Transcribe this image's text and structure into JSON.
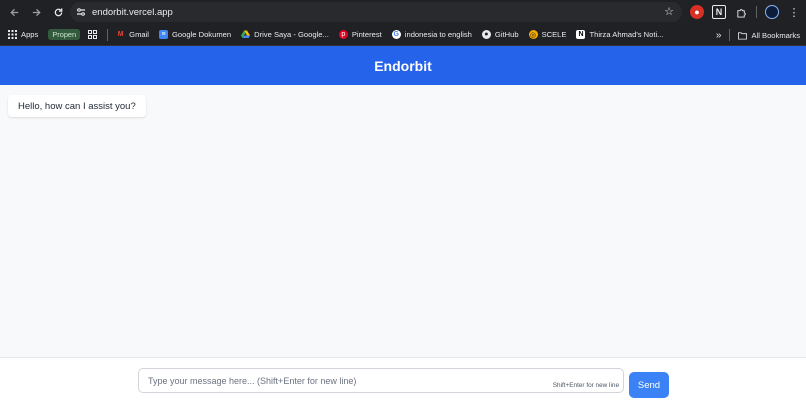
{
  "browser": {
    "url": "endorbit.vercel.app",
    "bookmarks": [
      {
        "label": "Apps",
        "icon": "apps-grid-icon"
      },
      {
        "label": "Propen",
        "icon": "folder-tag-icon"
      },
      {
        "label": "",
        "icon": "grid-icon"
      },
      {
        "label": "Gmail",
        "icon": "gmail-icon"
      },
      {
        "label": "Google Dokumen",
        "icon": "docs-icon"
      },
      {
        "label": "Drive Saya - Google...",
        "icon": "drive-icon"
      },
      {
        "label": "Pinterest",
        "icon": "pinterest-icon"
      },
      {
        "label": "indonesia to english",
        "icon": "google-icon"
      },
      {
        "label": "GitHub",
        "icon": "github-icon"
      },
      {
        "label": "SCELE",
        "icon": "scele-icon"
      },
      {
        "label": "Thirza Ahmad's Noti...",
        "icon": "notion-icon"
      }
    ],
    "all_bookmarks": "All Bookmarks",
    "more_chevron": "»"
  },
  "app": {
    "title": "Endorbit",
    "header_color": "#2563eb"
  },
  "messages": [
    {
      "role": "assistant",
      "text": "Hello, how can I assist you?"
    }
  ],
  "composer": {
    "placeholder": "Type your message here... (Shift+Enter for new line)",
    "value": "",
    "hint": "Shift+Enter for new line",
    "send_label": "Send",
    "send_color": "#3b82f6"
  }
}
